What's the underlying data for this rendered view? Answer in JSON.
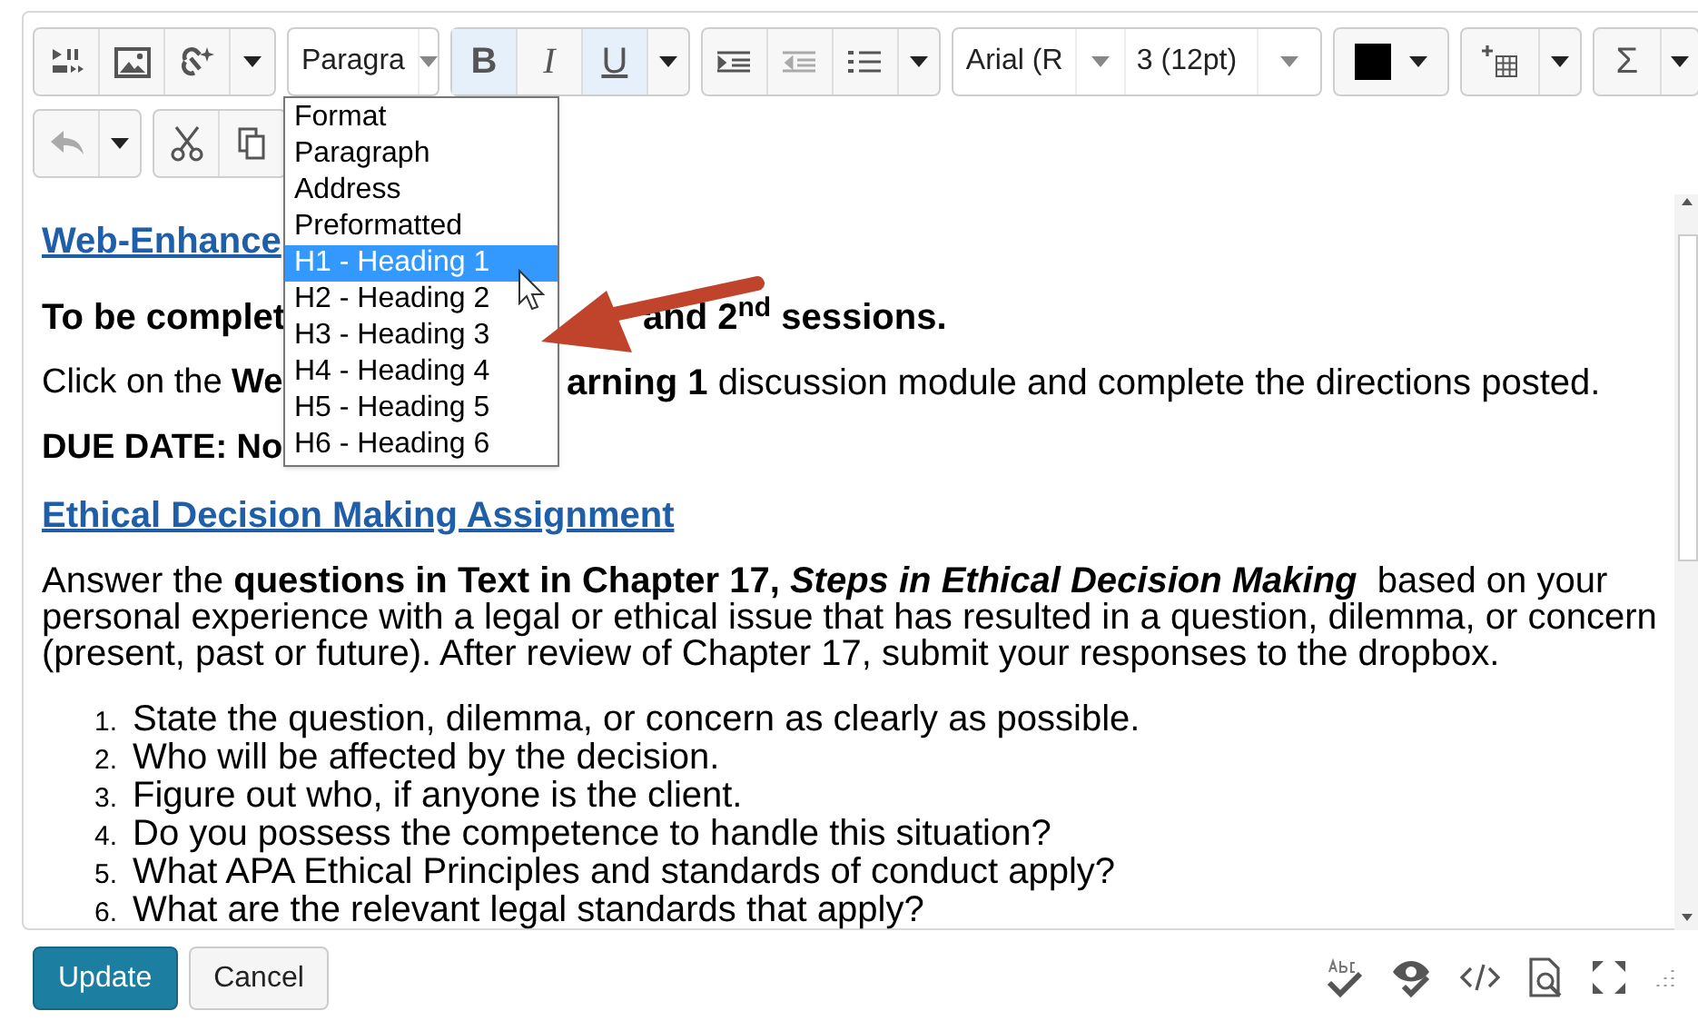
{
  "toolbar": {
    "format_select": {
      "value": "Paragra"
    },
    "style_buttons": [
      {
        "label": "B",
        "active": true,
        "kind": "bold"
      },
      {
        "label": "I",
        "active": false,
        "kind": "italic"
      },
      {
        "label": "U",
        "active": true,
        "kind": "underline"
      }
    ],
    "font_select": {
      "value": "Arial (R"
    },
    "size_select": {
      "value": "3 (12pt)"
    },
    "equation_button": {
      "label": "Σ"
    }
  },
  "format_menu": {
    "items": [
      {
        "label": "Format",
        "selected": false
      },
      {
        "label": "Paragraph",
        "selected": false
      },
      {
        "label": "Address",
        "selected": false
      },
      {
        "label": "Preformatted",
        "selected": false
      },
      {
        "label": "H1 - Heading 1",
        "selected": true
      },
      {
        "label": "H2 - Heading 2",
        "selected": false
      },
      {
        "label": "H3 - Heading 3",
        "selected": false
      },
      {
        "label": "H4 - Heading 4",
        "selected": false
      },
      {
        "label": "H5 - Heading 5",
        "selected": false
      },
      {
        "label": "H6 - Heading 6",
        "selected": false
      }
    ]
  },
  "editor": {
    "title_link": "Web-Enhance",
    "session_line": {
      "left": "To be complet",
      "right": "and 2$^{nd}$ sessions."
    },
    "click_line": {
      "left": "Click on the **We**",
      "right": "**arning 1** discussion module and complete the directions posted."
    },
    "due_line": {
      "left": "DUE DATE: No"
    },
    "assignment_link": "Ethical Decision Making Assignment",
    "paragraph": {
      "lead": "Answer the **questions in Text in Chapter 17,**",
      "emphasis": "Steps in Ethical Decision Making",
      "rest": "based on your personal experience with a legal or ethical issue that has resulted in a question, dilemma, or concern (present, past or future). After review of Chapter 17, submit your responses to the dropbox."
    },
    "steps": [
      {
        "number": "1.",
        "text": "State the question, dilemma, or concern as clearly as possible."
      },
      {
        "number": "2.",
        "text": "Who will be affected by the decision."
      },
      {
        "number": "3.",
        "text": "Figure out who, if anyone is the client."
      },
      {
        "number": "4.",
        "text": "Do you possess the competence to handle this situation?"
      },
      {
        "number": "5.",
        "text": "What APA Ethical Principles and standards of conduct apply?"
      },
      {
        "number": "6.",
        "text": "What are the relevant legal standards that apply?"
      }
    ]
  },
  "buttons": [
    {
      "label": "Update",
      "kind": "primary"
    },
    {
      "label": "Cancel",
      "kind": "secondary"
    }
  ]
}
